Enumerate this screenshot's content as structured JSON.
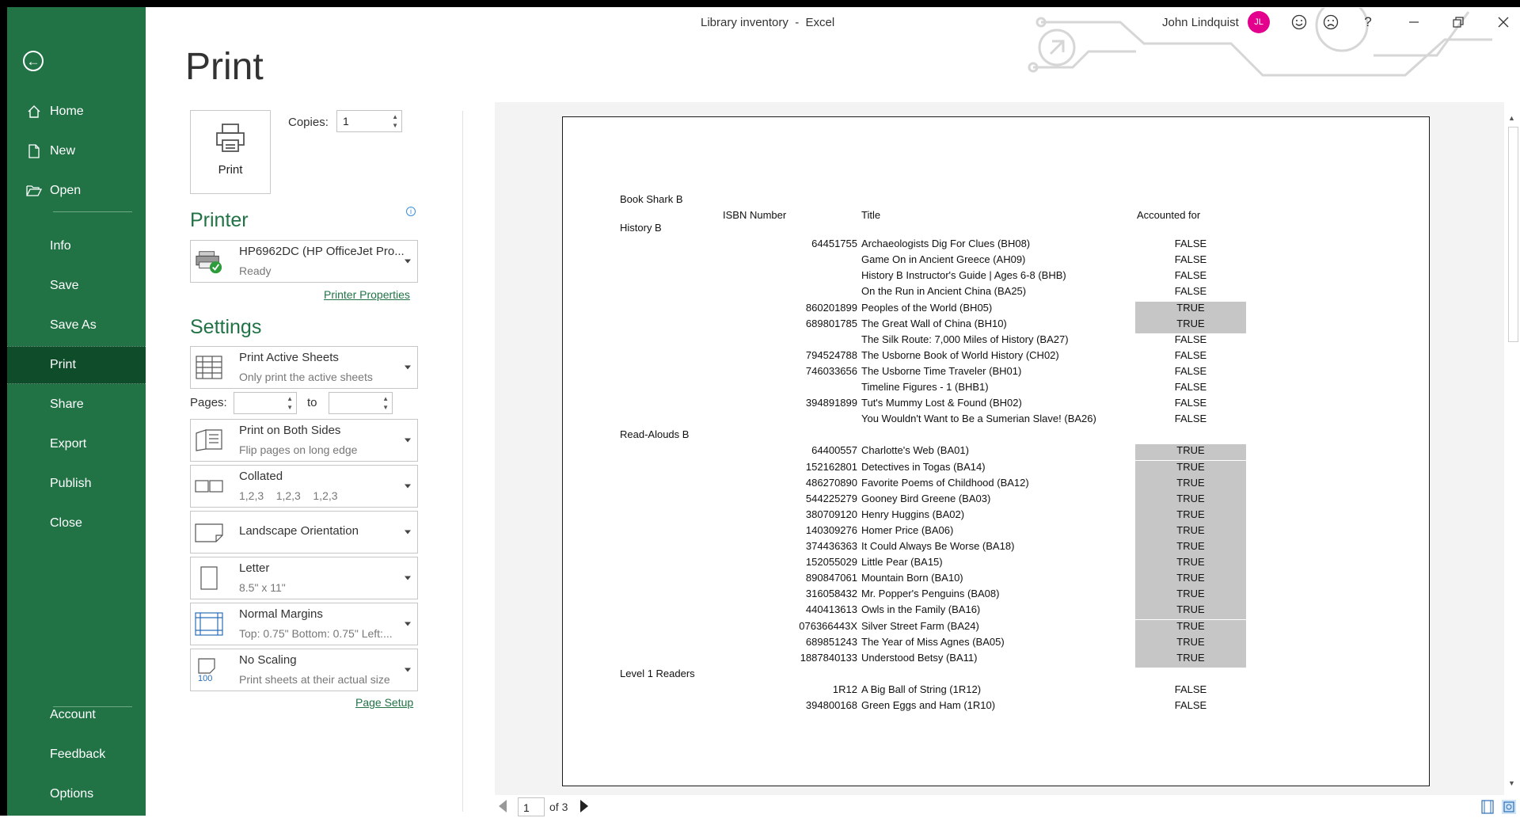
{
  "window": {
    "title": "Library inventory  -  Excel",
    "user_name": "John Lindquist",
    "avatar_initials": "JL",
    "help": "?"
  },
  "sidebar": {
    "items": [
      {
        "label": "Home",
        "icon": "home-icon"
      },
      {
        "label": "New",
        "icon": "new-document-icon"
      },
      {
        "label": "Open",
        "icon": "folder-open-icon"
      },
      {
        "label": "Info"
      },
      {
        "label": "Save"
      },
      {
        "label": "Save As"
      },
      {
        "label": "Print",
        "active": true
      },
      {
        "label": "Share"
      },
      {
        "label": "Export"
      },
      {
        "label": "Publish"
      },
      {
        "label": "Close"
      }
    ],
    "bottom_items": [
      {
        "label": "Account"
      },
      {
        "label": "Feedback"
      },
      {
        "label": "Options"
      }
    ]
  },
  "print": {
    "title": "Print",
    "print_button": "Print",
    "copies_label": "Copies:",
    "copies_value": "1",
    "printer_heading": "Printer",
    "printer_name": "HP6962DC (HP OfficeJet Pro...",
    "printer_status": "Ready",
    "printer_properties": "Printer Properties",
    "settings_heading": "Settings",
    "settings": [
      {
        "t1": "Print Active Sheets",
        "t2": "Only print the active sheets"
      },
      {
        "t1": "Print on Both Sides",
        "t2": "Flip pages on long edge"
      },
      {
        "t1": "Collated",
        "t2": "1,2,3    1,2,3    1,2,3"
      },
      {
        "t1": "Landscape Orientation",
        "t2": ""
      },
      {
        "t1": "Letter",
        "t2": "8.5\" x 11\""
      },
      {
        "t1": "Normal Margins",
        "t2": "Top: 0.75\" Bottom: 0.75\" Left:..."
      },
      {
        "t1": "No Scaling",
        "t2": "Print sheets at their actual size"
      }
    ],
    "pages_label": "Pages:",
    "to_label": "to",
    "page_setup": "Page Setup",
    "scaling_icon_text": "100"
  },
  "preview": {
    "sheet_title": "Book Shark B",
    "headers": {
      "isbn": "ISBN Number",
      "title": "Title",
      "accounted": "Accounted for"
    },
    "groups": [
      {
        "name": "History B",
        "rows": [
          {
            "isbn": "64451755",
            "title": "Archaeologists Dig For Clues (BH08)",
            "acc": "FALSE"
          },
          {
            "isbn": "",
            "title": "Game On in Ancient Greece (AH09)",
            "acc": "FALSE"
          },
          {
            "isbn": "",
            "title": "History B Instructor's Guide | Ages 6-8 (BHB)",
            "acc": "FALSE"
          },
          {
            "isbn": "",
            "title": "On the Run in Ancient China (BA25)",
            "acc": "FALSE"
          },
          {
            "isbn": "860201899",
            "title": "Peoples of the World (BH05)",
            "acc": "TRUE"
          },
          {
            "isbn": "689801785",
            "title": "The Great Wall of China (BH10)",
            "acc": "TRUE"
          },
          {
            "isbn": "",
            "title": "The Silk Route: 7,000 Miles of History (BA27)",
            "acc": "FALSE"
          },
          {
            "isbn": "794524788",
            "title": "The Usborne Book of World History (CH02)",
            "acc": "FALSE"
          },
          {
            "isbn": "746033656",
            "title": "The Usborne Time Traveler (BH01)",
            "acc": "FALSE"
          },
          {
            "isbn": "",
            "title": "Timeline Figures - 1 (BHB1)",
            "acc": "FALSE"
          },
          {
            "isbn": "394891899",
            "title": "Tut's Mummy Lost & Found (BH02)",
            "acc": "FALSE"
          },
          {
            "isbn": "",
            "title": "You Wouldn't Want to Be a Sumerian Slave! (BA26)",
            "acc": "FALSE"
          }
        ]
      },
      {
        "name": "Read-Alouds B",
        "rows": [
          {
            "isbn": "64400557",
            "title": "Charlotte's Web (BA01)",
            "acc": "TRUE"
          },
          {
            "isbn": "152162801",
            "title": "Detectives in Togas (BA14)",
            "acc": "TRUE"
          },
          {
            "isbn": "486270890",
            "title": "Favorite Poems of Childhood (BA12)",
            "acc": "TRUE"
          },
          {
            "isbn": "544225279",
            "title": "Gooney Bird Greene (BA03)",
            "acc": "TRUE"
          },
          {
            "isbn": "380709120",
            "title": "Henry Huggins (BA02)",
            "acc": "TRUE"
          },
          {
            "isbn": "140309276",
            "title": "Homer Price (BA06)",
            "acc": "TRUE"
          },
          {
            "isbn": "374436363",
            "title": "It Could Always Be Worse (BA18)",
            "acc": "TRUE"
          },
          {
            "isbn": "152055029",
            "title": "Little Pear (BA15)",
            "acc": "TRUE"
          },
          {
            "isbn": "890847061",
            "title": "Mountain Born (BA10)",
            "acc": "TRUE"
          },
          {
            "isbn": "316058432",
            "title": "Mr. Popper's Penguins (BA08)",
            "acc": "TRUE"
          },
          {
            "isbn": "440413613",
            "title": "Owls in the Family (BA16)",
            "acc": "TRUE"
          },
          {
            "isbn": "076366443X",
            "title": "Silver Street Farm (BA24)",
            "acc": "TRUE"
          },
          {
            "isbn": "689851243",
            "title": "The Year of Miss Agnes (BA05)",
            "acc": "TRUE"
          },
          {
            "isbn": "1887840133",
            "title": "Understood Betsy (BA11)",
            "acc": "TRUE"
          }
        ]
      },
      {
        "name": "Level 1 Readers",
        "rows": [
          {
            "isbn": "1R12",
            "title": "A Big Ball of String (1R12)",
            "acc": "FALSE"
          },
          {
            "isbn": "394800168",
            "title": "Green Eggs and Ham (1R10)",
            "acc": "FALSE"
          }
        ]
      }
    ],
    "page_current": "1",
    "page_of": "of 3"
  },
  "colors": {
    "accent": "#217346",
    "accent_dark": "#0e4c2a",
    "highlight": "#c6c6c6",
    "avatar": "#e3008c"
  }
}
